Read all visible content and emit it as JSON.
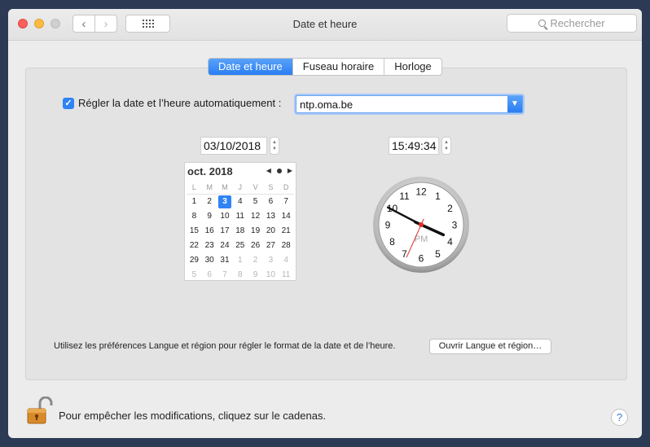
{
  "window": {
    "title": "Date et heure"
  },
  "search": {
    "placeholder": "Rechercher"
  },
  "tabs": [
    {
      "label": "Date et heure",
      "active": true
    },
    {
      "label": "Fuseau horaire",
      "active": false
    },
    {
      "label": "Horloge",
      "active": false
    }
  ],
  "auto": {
    "label": "Régler la date et l’heure automatiquement :",
    "checked": true,
    "server": "ntp.oma.be"
  },
  "date_field": "03/10/2018",
  "time_field": "15:49:34",
  "calendar": {
    "month_label": "oct. 2018",
    "weekdays": [
      "L",
      "M",
      "M",
      "J",
      "V",
      "S",
      "D"
    ],
    "weeks": [
      [
        {
          "d": "1"
        },
        {
          "d": "2"
        },
        {
          "d": "3",
          "sel": true
        },
        {
          "d": "4"
        },
        {
          "d": "5"
        },
        {
          "d": "6"
        },
        {
          "d": "7"
        }
      ],
      [
        {
          "d": "8"
        },
        {
          "d": "9"
        },
        {
          "d": "10"
        },
        {
          "d": "11"
        },
        {
          "d": "12"
        },
        {
          "d": "13"
        },
        {
          "d": "14"
        }
      ],
      [
        {
          "d": "15"
        },
        {
          "d": "16"
        },
        {
          "d": "17"
        },
        {
          "d": "18"
        },
        {
          "d": "19"
        },
        {
          "d": "20"
        },
        {
          "d": "21"
        }
      ],
      [
        {
          "d": "22"
        },
        {
          "d": "23"
        },
        {
          "d": "24"
        },
        {
          "d": "25"
        },
        {
          "d": "26"
        },
        {
          "d": "27"
        },
        {
          "d": "28"
        }
      ],
      [
        {
          "d": "29"
        },
        {
          "d": "30"
        },
        {
          "d": "31"
        },
        {
          "d": "1",
          "other": true
        },
        {
          "d": "2",
          "other": true
        },
        {
          "d": "3",
          "other": true
        },
        {
          "d": "4",
          "other": true
        }
      ],
      [
        {
          "d": "5",
          "other": true
        },
        {
          "d": "6",
          "other": true
        },
        {
          "d": "7",
          "other": true
        },
        {
          "d": "8",
          "other": true
        },
        {
          "d": "9",
          "other": true
        },
        {
          "d": "10",
          "other": true
        },
        {
          "d": "11",
          "other": true
        }
      ]
    ]
  },
  "clock": {
    "ampm": "PM",
    "numbers": [
      "12",
      "1",
      "2",
      "3",
      "4",
      "5",
      "6",
      "7",
      "8",
      "9",
      "10",
      "11"
    ],
    "hour": 15,
    "minute": 49,
    "second": 34
  },
  "language": {
    "text": "Utilisez les préférences Langue et région pour régler le format de la date et de l’heure.",
    "button": "Ouvrir Langue et région…"
  },
  "lock": {
    "text": "Pour empêcher les modifications, cliquez sur le cadenas."
  },
  "help": {
    "label": "?"
  },
  "colors": {
    "accent": "#2f83f5",
    "second_hand": "#e0302a"
  }
}
